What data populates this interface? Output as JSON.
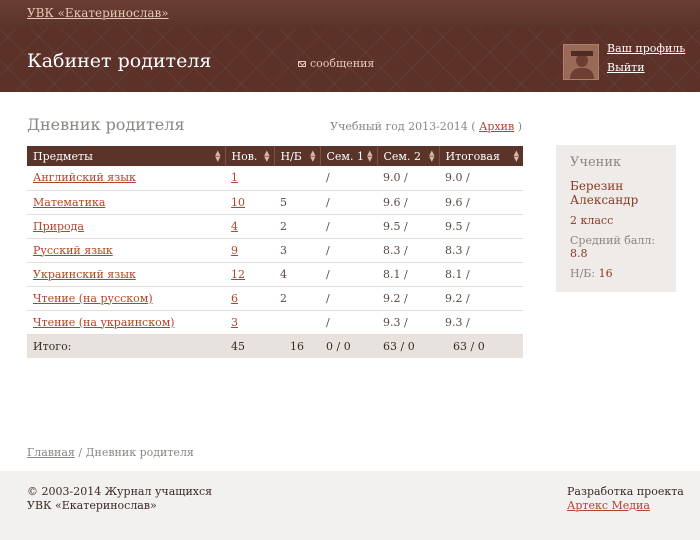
{
  "topbar": {
    "school": "УВК «Екатеринослав»"
  },
  "header": {
    "title": "Кабинет родителя",
    "messages": "сообщения",
    "profile": "Ваш профиль",
    "logout": "Выйти"
  },
  "diary": {
    "title": "Дневник родителя",
    "year_prefix": "Учебный год 2013-2014 (",
    "archive": "Архив",
    "year_suffix": ")"
  },
  "table": {
    "headers": [
      "Предметы",
      "Нов.",
      "Н/Б",
      "Сем. 1",
      "Сем. 2",
      "Итоговая"
    ],
    "rows": [
      [
        "Английский язык",
        "1",
        "",
        "/",
        "9.0 /",
        "9.0 /"
      ],
      [
        "Математика",
        "10",
        "5",
        "/",
        "9.6 /",
        "9.6 /"
      ],
      [
        "Природа",
        "4",
        "2",
        "/",
        "9.5 /",
        "9.5 /"
      ],
      [
        "Русский язык",
        "9",
        "3",
        "/",
        "8.3 /",
        "8.3 /"
      ],
      [
        "Украинский язык",
        "12",
        "4",
        "/",
        "8.1 /",
        "8.1 /"
      ],
      [
        "Чтение (на русском)",
        "6",
        "2",
        "/",
        "9.2 /",
        "9.2 /"
      ],
      [
        "Чтение (на украинском)",
        "3",
        "",
        "/",
        "9.3 /",
        "9.3 /"
      ]
    ],
    "total": [
      "Итого:",
      "45",
      "16",
      "0 / 0",
      "63 / 0",
      "63 / 0"
    ]
  },
  "pupil": {
    "label": "Ученик",
    "name_line1": "Березин",
    "name_line2": "Александр",
    "grade": "2 класс",
    "avg_label": "Средний балл:",
    "avg_value": "8.8",
    "nb_label": "Н/Б:",
    "nb_value": "16"
  },
  "breadcrumb": {
    "home": "Главная",
    "separator": " / ",
    "current": "Дневник родителя"
  },
  "footer": {
    "copy_line1": "© 2003-2014 Журнал учащихся",
    "copy_line2": "УВК «Екатеринослав»",
    "dev_label": "Разработка проекта",
    "dev_link": "Артекс Медиа"
  }
}
